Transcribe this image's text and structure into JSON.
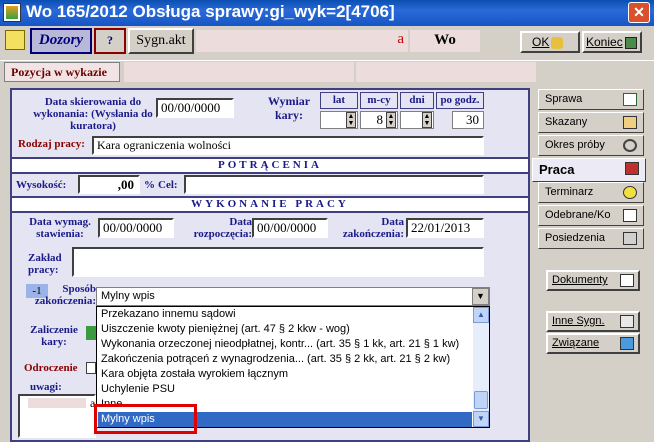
{
  "window": {
    "title": "Wo 165/2012  Obsługa sprawy:gi_wyk=2[4706]",
    "close": "✕"
  },
  "toolbar": {
    "dozory": "Dozory",
    "help": "?",
    "sygn_akt": "Sygn.akt",
    "case_number_fragment": "a",
    "case_type": "Wo",
    "ok": "OK",
    "koniec": "Koniec"
  },
  "position": {
    "label": "Pozycja w wykazie"
  },
  "form": {
    "data_skierowania_label": "Data skierowania do wykonania: (Wysłania do kuratora)",
    "data_skierowania_value": "00/00/0000",
    "wymiar_kary_label": "Wymiar kary:",
    "wymiar_headers": [
      "lat",
      "m-cy",
      "dni",
      "po godz."
    ],
    "wymiar_values": {
      "lat": "",
      "mcy": "8",
      "dni": "",
      "godz": "30"
    },
    "rodzaj_pracy_label": "Rodzaj pracy:",
    "rodzaj_pracy_value": "Kara ograniczenia wolności",
    "potracenia_header": "POTRĄCENIA",
    "wysokosc_label": "Wysokość:",
    "wysokosc_value": ",00",
    "percent": "%",
    "cel_label": "Cel:",
    "wykonanie_header": "WYKONANIE PRACY",
    "data_wymag_label": "Data wymag. stawienia:",
    "data_wymag_value": "00/00/0000",
    "data_rozp_label": "Data rozpoczęcia:",
    "data_rozp_value": "00/00/0000",
    "data_zak_label": "Data zakończenia:",
    "data_zak_value": "22/01/2013",
    "zaklad_label": "Zakład pracy:",
    "sposob_code": "-1",
    "sposob_label": "Sposób zakończenia:",
    "sposob_value": "Mylny wpis",
    "zaliczenie_label": "Zaliczenie kary:",
    "odroczenie_label": "Odroczenie",
    "uwagi_label": "uwagi:",
    "uwagi_fragment": "a"
  },
  "dropdown_options": [
    "Przekazano innemu sądowi",
    "Uiszczenie kwoty pieniężnej (art. 47 § 2 kkw - wog)",
    "Wykonania orzeczonej nieodpłatnej, kontr... (art. 35 § 1 kk, art. 21 § 1 kw)",
    "Zakończenia potrąceń z wynagrodzenia... (art. 35 § 2 kk, art. 21 § 2 kw)",
    "Kara objęta została wyrokiem łącznym",
    "Uchylenie PSU",
    "Inne",
    "Mylny wpis"
  ],
  "selected_option_index": 7,
  "sidebar": {
    "tabs": [
      "Sprawa",
      "Skazany",
      "Okres próby",
      "Praca",
      "Terminarz",
      "Odebrane/Ko",
      "Posiedzenia"
    ],
    "active_tab": "Praca",
    "buttons": [
      "Dokumenty",
      "Inne Sygn.",
      "Związane"
    ]
  },
  "colors": {
    "title_bar": "#1656c4",
    "selection": "#316ac5",
    "highlight_box": "#e00000",
    "panel": "#e4e4f2"
  }
}
